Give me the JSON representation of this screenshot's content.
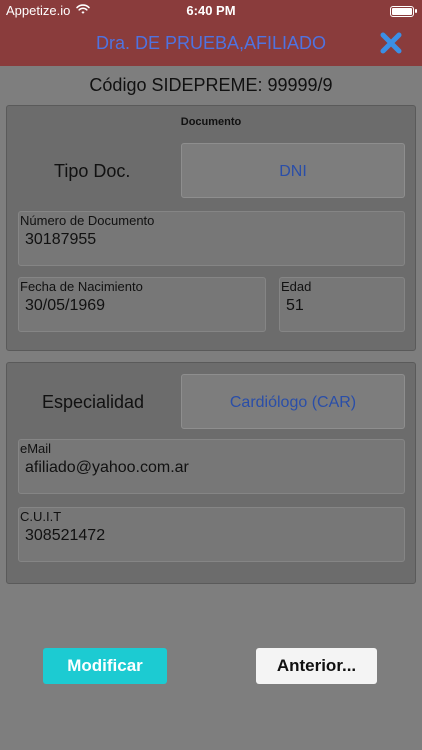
{
  "status_bar": {
    "carrier": "Appetize.io",
    "time": "6:40 PM"
  },
  "nav": {
    "title": "Dra. DE PRUEBA,AFILIADO",
    "title_color": "#4f73e0",
    "close_icon": "close-x-icon",
    "bar_color": "#8a3c3c"
  },
  "code_line": "Código SIDEPREME: 99999/9",
  "documento": {
    "title": "Documento",
    "tipo_label": "Tipo Doc.",
    "tipo_value": "DNI",
    "numero_label": "Número de Documento",
    "numero_value": "30187955",
    "fecha_label": "Fecha de Nacimiento",
    "fecha_value": "30/05/1969",
    "edad_label": "Edad",
    "edad_value": "51"
  },
  "contacto": {
    "especialidad_label": "Especialidad",
    "especialidad_value": "Cardiólogo (CAR)",
    "email_label": "eMail",
    "email_value": "afiliado@yahoo.com.ar",
    "cuit_label": "C.U.I.T",
    "cuit_value": "308521472"
  },
  "buttons": {
    "modify": "Modificar",
    "back": "Anterior...",
    "modify_color": "#1ccbd2"
  }
}
